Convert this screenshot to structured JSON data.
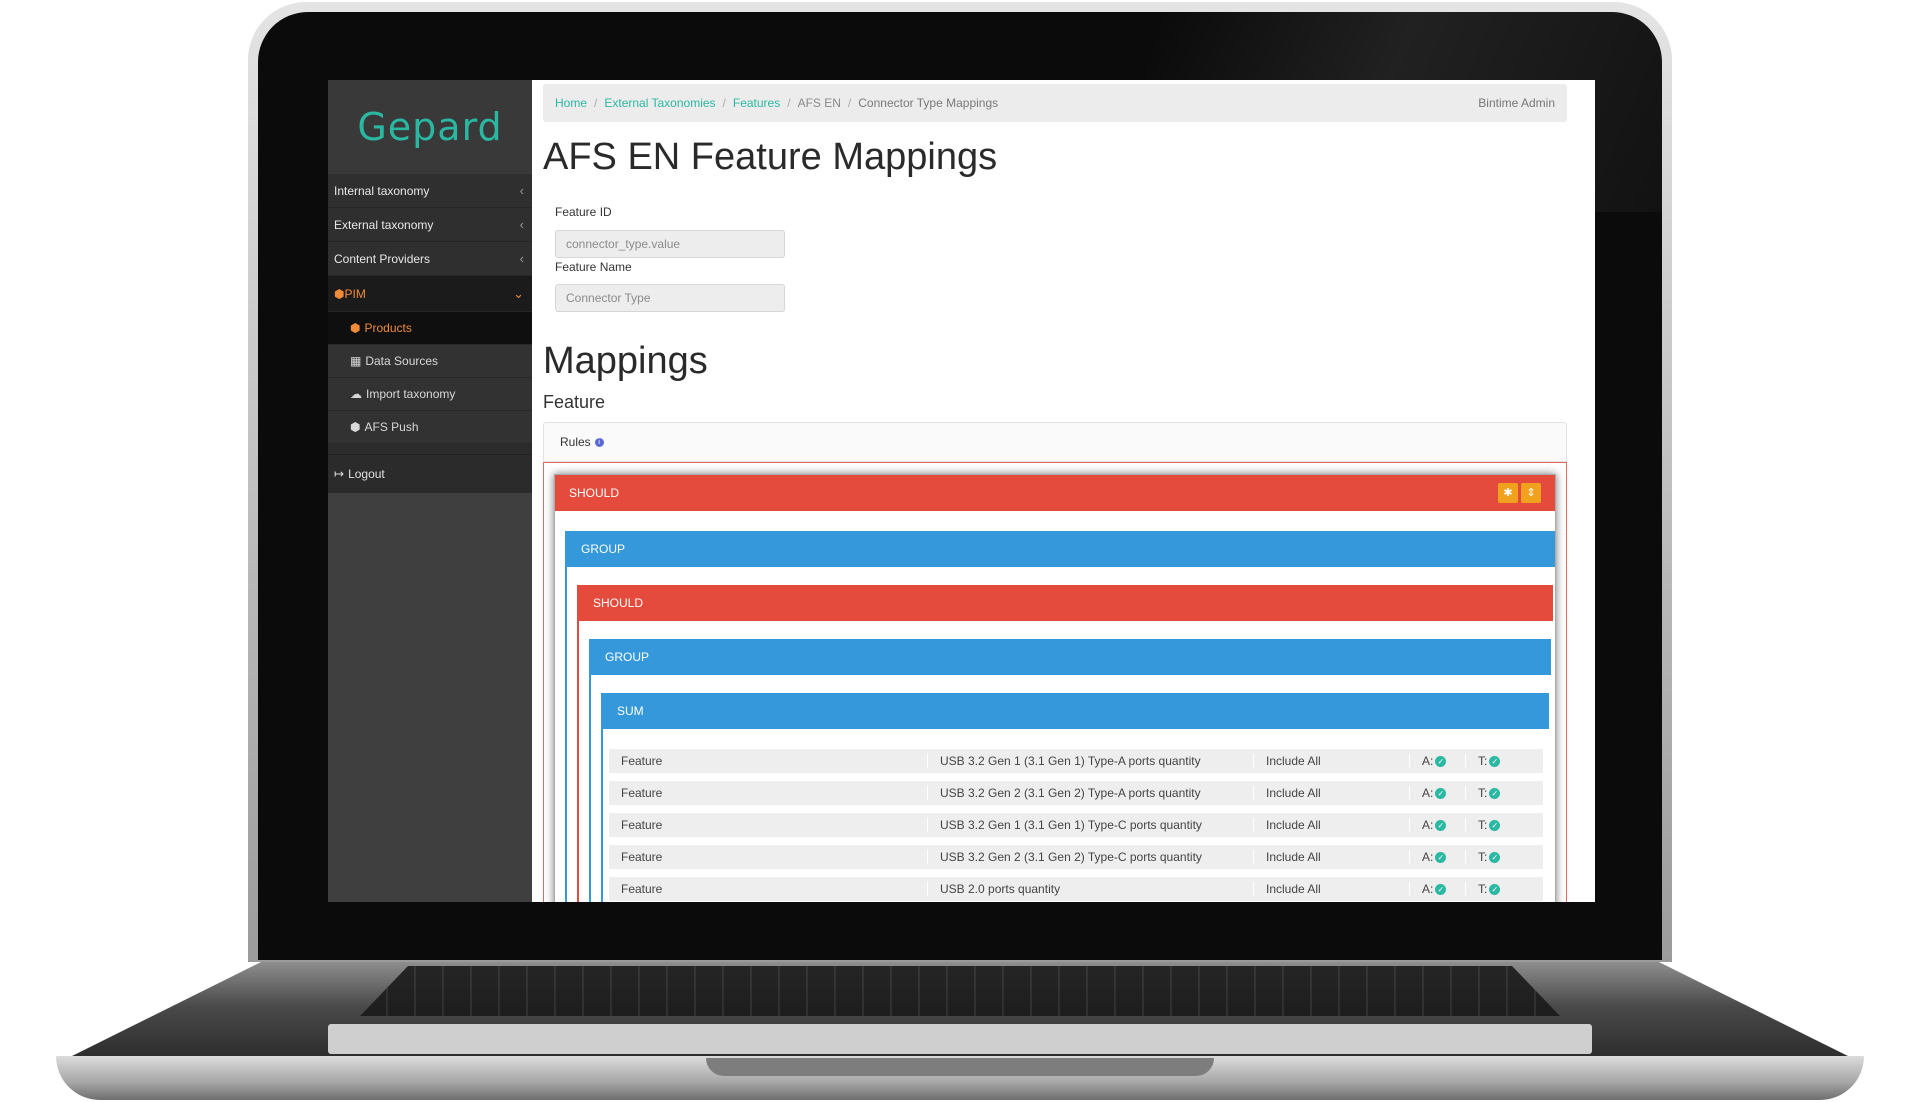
{
  "app": {
    "logo": "Gepard",
    "colors": {
      "accent": "#2bb8a2",
      "pim": "#f08b3a",
      "should": "#e54b3c",
      "group": "#3498db",
      "sidebar": "#3f3f3f"
    }
  },
  "sidebar": {
    "items": [
      {
        "label": "Internal taxonomy",
        "icon": "chevron-left-icon"
      },
      {
        "label": "External taxonomy",
        "icon": "chevron-left-icon"
      },
      {
        "label": "Content Providers",
        "icon": "chevron-left-icon"
      },
      {
        "label": "PIM",
        "icon": "cube-icon"
      }
    ],
    "subitems": [
      {
        "label": "Products",
        "icon": "cubes-icon"
      },
      {
        "label": "Data Sources",
        "icon": "sitemap-icon"
      },
      {
        "label": "Import taxonomy",
        "icon": "cloud-upload-icon"
      },
      {
        "label": "AFS Push",
        "icon": "cubes-icon"
      }
    ],
    "logout": "Logout"
  },
  "breadcrumb": {
    "items": [
      "Home",
      "External Taxonomies",
      "Features",
      "AFS EN",
      "Connector Type Mappings"
    ],
    "user": "Bintime Admin"
  },
  "page": {
    "title": "AFS EN Feature Mappings",
    "feature_id_label": "Feature ID",
    "feature_id_value": "connector_type.value",
    "feature_name_label": "Feature Name",
    "feature_name_value": "Connector Type",
    "mappings_heading": "Mappings",
    "feature_heading": "Feature",
    "rules_label": "Rules"
  },
  "rules": {
    "blocks": [
      "SHOULD",
      "GROUP",
      "SHOULD",
      "GROUP",
      "SUM"
    ],
    "rows": [
      {
        "type": "Feature",
        "name": "USB 3.2 Gen 1 (3.1 Gen 1) Type-A ports quantity",
        "mode": "Include All",
        "a": "A:",
        "t": "T:"
      },
      {
        "type": "Feature",
        "name": "USB 3.2 Gen 2 (3.1 Gen 2) Type-A ports quantity",
        "mode": "Include All",
        "a": "A:",
        "t": "T:"
      },
      {
        "type": "Feature",
        "name": "USB 3.2 Gen 1 (3.1 Gen 1) Type-C ports quantity",
        "mode": "Include All",
        "a": "A:",
        "t": "T:"
      },
      {
        "type": "Feature",
        "name": "USB 3.2 Gen 2 (3.1 Gen 2) Type-C ports quantity",
        "mode": "Include All",
        "a": "A:",
        "t": "T:"
      },
      {
        "type": "Feature",
        "name": "USB 2.0 ports quantity",
        "mode": "Include All",
        "a": "A:",
        "t": "T:"
      }
    ]
  }
}
